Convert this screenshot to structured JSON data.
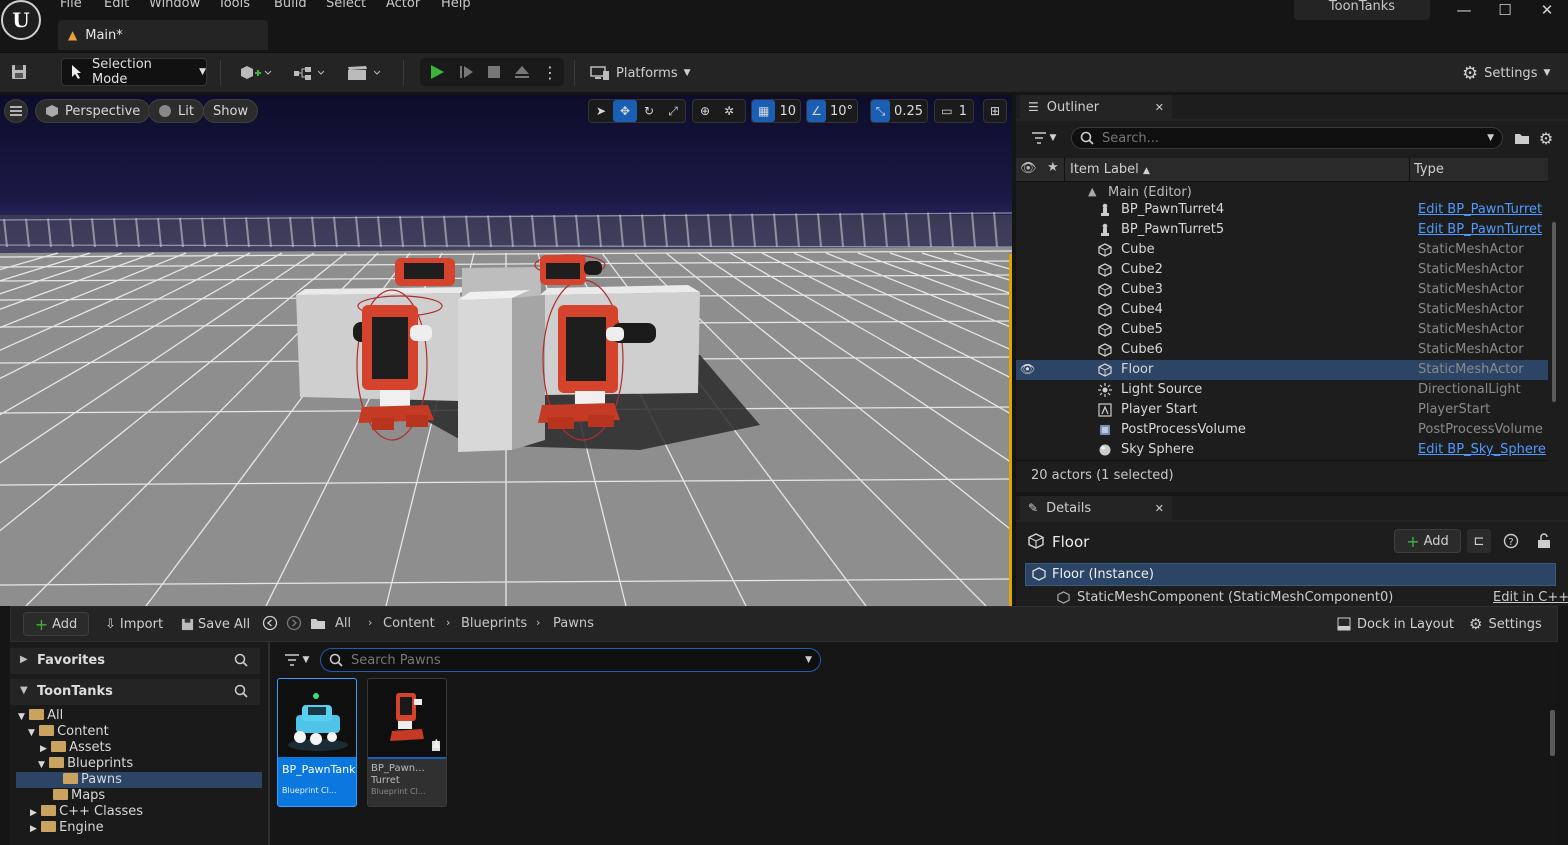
{
  "titlebar": {
    "logo": "U",
    "menus": [
      "File",
      "Edit",
      "Window",
      "Tools",
      "Build",
      "Select",
      "Actor",
      "Help"
    ],
    "project": "ToonTanks",
    "doc_tab": "Main*"
  },
  "toolbar": {
    "mode": "Selection Mode",
    "platforms": "Platforms",
    "settings": "Settings"
  },
  "viewport": {
    "perspective": "Perspective",
    "lit": "Lit",
    "show": "Show",
    "grid_snap": "10",
    "rot_snap": "10°",
    "scale_snap": "0.25",
    "camera_speed": "1"
  },
  "outliner": {
    "tab": "Outliner",
    "search_placeholder": "Search...",
    "col_label": "Item Label",
    "col_type": "Type",
    "world": "Main (Editor)",
    "rows": [
      {
        "label": "BP_PawnTurret4",
        "type": "Edit BP_PawnTurret",
        "icon": "pawn-icon"
      },
      {
        "label": "BP_PawnTurret5",
        "type": "Edit BP_PawnTurret",
        "icon": "pawn-icon"
      },
      {
        "label": "Cube",
        "type": "StaticMeshActor",
        "icon": "cube-icon"
      },
      {
        "label": "Cube2",
        "type": "StaticMeshActor",
        "icon": "cube-icon"
      },
      {
        "label": "Cube3",
        "type": "StaticMeshActor",
        "icon": "cube-icon"
      },
      {
        "label": "Cube4",
        "type": "StaticMeshActor",
        "icon": "cube-icon"
      },
      {
        "label": "Cube5",
        "type": "StaticMeshActor",
        "icon": "cube-icon"
      },
      {
        "label": "Cube6",
        "type": "StaticMeshActor",
        "icon": "cube-icon"
      },
      {
        "label": "Floor",
        "type": "StaticMeshActor",
        "icon": "cube-icon"
      },
      {
        "label": "Light Source",
        "type": "DirectionalLight",
        "icon": "light-icon"
      },
      {
        "label": "Player Start",
        "type": "PlayerStart",
        "icon": "player-start-icon"
      },
      {
        "label": "PostProcessVolume",
        "type": "PostProcessVolume",
        "icon": "volume-icon"
      },
      {
        "label": "Sky Sphere",
        "type": "Edit BP_Sky_Sphere",
        "icon": "sphere-icon"
      }
    ],
    "status": "20 actors (1 selected)"
  },
  "details": {
    "tab": "Details",
    "object": "Floor",
    "add": "Add",
    "instance": "Floor (Instance)",
    "component": "StaticMeshComponent (StaticMeshComponent0)",
    "edit_cpp": "Edit in C++"
  },
  "content_browser": {
    "add": "Add",
    "import": "Import",
    "save_all": "Save All",
    "path": [
      "All",
      "Content",
      "Blueprints",
      "Pawns"
    ],
    "dock": "Dock in Layout",
    "settings": "Settings",
    "favorites": "Favorites",
    "project": "ToonTanks",
    "search_placeholder": "Search Pawns",
    "tree": {
      "all": "All",
      "content": "Content",
      "assets": "Assets",
      "blueprints": "Blueprints",
      "pawns": "Pawns",
      "maps": "Maps",
      "cpp": "C++ Classes",
      "engine": "Engine"
    },
    "assets": [
      {
        "name": "BP_PawnTank",
        "type": "Blueprint Cl..."
      },
      {
        "name": "BP_Pawn...",
        "name2": "Turret",
        "type": "Blueprint Cl..."
      }
    ]
  },
  "colors": {
    "accent": "#1a5fb4",
    "selection": "#2c4566",
    "play": "#3cb33c",
    "viewport_border": "#e4a400",
    "link": "#4f9bff"
  }
}
